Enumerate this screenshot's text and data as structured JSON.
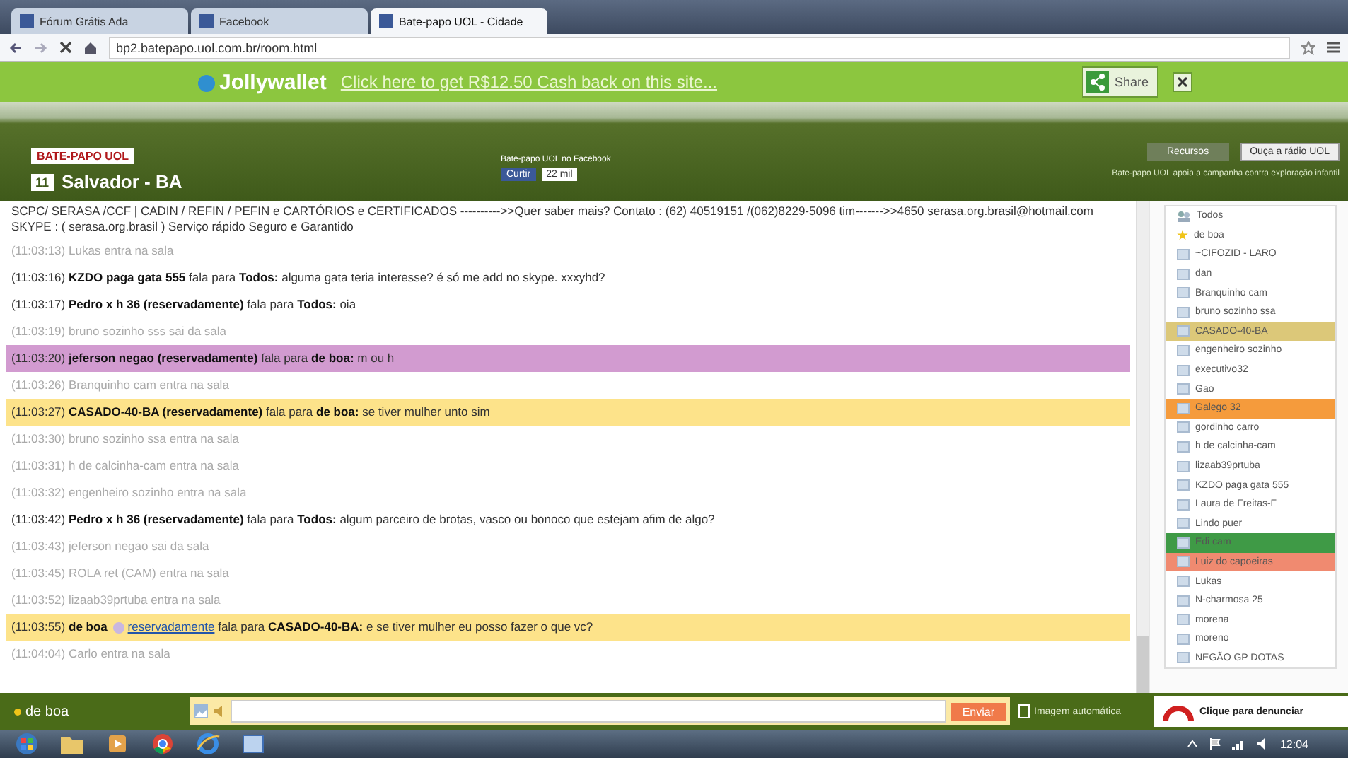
{
  "browser": {
    "tabs": [
      {
        "title": "Fórum Grátis Ada",
        "selected": false
      },
      {
        "title": "Facebook",
        "selected": false
      },
      {
        "title": "Bate-papo UOL - Cidade",
        "selected": true
      }
    ],
    "address": "bp2.batepapo.uol.com.br/room.html"
  },
  "banner": {
    "brand": "Jollywallet",
    "offer": "Click here to get R$12.50 Cash back on this site...",
    "share": "Share"
  },
  "header": {
    "logo": "BATE-PAPO UOL",
    "room_number": "11",
    "room": "Salvador - BA",
    "facebook_text": "Bate-papo UOL no Facebook",
    "like": "Curtir",
    "like_count": "22 mil",
    "resources": "Recursos",
    "radio": "Ouça a rádio UOL",
    "notice": "Bate-papo UOL apoia a campanha contra exploração infantil"
  },
  "messages": [
    {
      "kind": "notice",
      "text": "SCPC/ SERASA /CCF | CADIN / REFIN / PEFIN e CARTÓRIOS e CERTIFICADOS ---------->>Quer saber mais? Contato : (62) 40519151 /(062)8229-5096 tim------->>4650 serasa.org.brasil@hotmail.com SKYPE : ( serasa.org.brasil ) Serviço rápido Seguro e Garantido"
    },
    {
      "kind": "system",
      "time": "(11:03:13)",
      "user": "Lukas",
      "action": "entra na sala"
    },
    {
      "kind": "talk",
      "time": "(11:03:16)",
      "sender": "KZDO paga gata 555",
      "verb": "fala para",
      "recipient": "Todos:",
      "text": "alguma gata teria interesse? é só me add no skype. xxxyhd?"
    },
    {
      "kind": "talk",
      "time": "(11:03:17)",
      "sender": "Pedro x h 36 (reservadamente)",
      "verb": "fala para",
      "recipient": "Todos:",
      "text": "oia"
    },
    {
      "kind": "system",
      "time": "(11:03:19)",
      "user": "bruno sozinho sss",
      "action": "sai da sala"
    },
    {
      "kind": "talk",
      "time": "(11:03:20)",
      "sender": "jeferson negao (reservadamente)",
      "verb": "fala para",
      "recipient": "de boa:",
      "text": "m ou h",
      "color": "#d29bd0"
    },
    {
      "kind": "system",
      "time": "(11:03:26)",
      "user": "Branquinho cam",
      "action": "entra na sala"
    },
    {
      "kind": "talk",
      "time": "(11:03:27)",
      "sender": "CASADO-40-BA (reservadamente)",
      "verb": "fala para",
      "recipient": "de boa:",
      "text": "se tiver mulher unto sim",
      "color": "#fde38a"
    },
    {
      "kind": "system",
      "time": "(11:03:30)",
      "user": "bruno sozinho ssa",
      "action": "entra na sala"
    },
    {
      "kind": "system",
      "time": "(11:03:31)",
      "user": "h de calcinha-cam",
      "action": "entra na sala"
    },
    {
      "kind": "system",
      "time": "(11:03:32)",
      "user": "engenheiro sozinho",
      "action": "entra na sala"
    },
    {
      "kind": "talk",
      "time": "(11:03:42)",
      "sender": "Pedro x h 36 (reservadamente)",
      "verb": "fala para",
      "recipient": "Todos:",
      "text": "algum parceiro de brotas, vasco ou bonoco que estejam afim de algo?"
    },
    {
      "kind": "system",
      "time": "(11:03:43)",
      "user": "jeferson negao",
      "action": "sai da sala"
    },
    {
      "kind": "system",
      "time": "(11:03:45)",
      "user": "ROLA ret (CAM)",
      "action": "entra na sala"
    },
    {
      "kind": "system",
      "time": "(11:03:52)",
      "user": "lizaab39prtuba",
      "action": "entra na sala"
    },
    {
      "kind": "talk",
      "time": "(11:03:55)",
      "sender": "de boa",
      "link": "reservadamente",
      "verb": "fala para",
      "recipient": "CASADO-40-BA:",
      "text": "e se tiver mulher eu posso fazer o que vc?",
      "color": "#fde38a"
    },
    {
      "kind": "system",
      "time": "(11:04:04)",
      "user": "Carlo",
      "action": "entra na sala"
    }
  ],
  "users": {
    "root": "Todos",
    "items": [
      {
        "name": "de boa",
        "kind": "self"
      },
      {
        "name": "~CIFOZID - LARO",
        "kind": "user"
      },
      {
        "name": "dan",
        "kind": "user"
      },
      {
        "name": "Branquinho cam",
        "kind": "user"
      },
      {
        "name": "bruno sozinho ssa",
        "kind": "user"
      },
      {
        "name": "CASADO-40-BA",
        "kind": "user",
        "color": "#dcc879"
      },
      {
        "name": "engenheiro sozinho",
        "kind": "user"
      },
      {
        "name": "executivo32",
        "kind": "user"
      },
      {
        "name": "Gao",
        "kind": "user"
      },
      {
        "name": "Galego 32",
        "kind": "user",
        "color": "#f59b3c"
      },
      {
        "name": "gordinho carro",
        "kind": "user"
      },
      {
        "name": "h de calcinha-cam",
        "kind": "user"
      },
      {
        "name": "lizaab39prtuba",
        "kind": "user"
      },
      {
        "name": "KZDO paga gata 555",
        "kind": "user"
      },
      {
        "name": "Laura de Freitas-F",
        "kind": "user"
      },
      {
        "name": "Lindo puer",
        "kind": "user"
      },
      {
        "name": "Edi cam",
        "kind": "user",
        "color": "#3f9a46"
      },
      {
        "name": "Luiz do capoeiras",
        "kind": "user",
        "color": "#f08a70"
      },
      {
        "name": "Lukas",
        "kind": "user"
      },
      {
        "name": "N-charmosa 25",
        "kind": "user"
      },
      {
        "name": "morena",
        "kind": "user"
      },
      {
        "name": "moreno",
        "kind": "user"
      },
      {
        "name": "NEGÃO GP DOTAS",
        "kind": "user"
      }
    ]
  },
  "composer": {
    "nick": "de boa",
    "send": "Enviar",
    "auto_image": "Imagem automática",
    "report": "Clique para denunciar"
  },
  "taskbar": {
    "clock": "12:04"
  }
}
